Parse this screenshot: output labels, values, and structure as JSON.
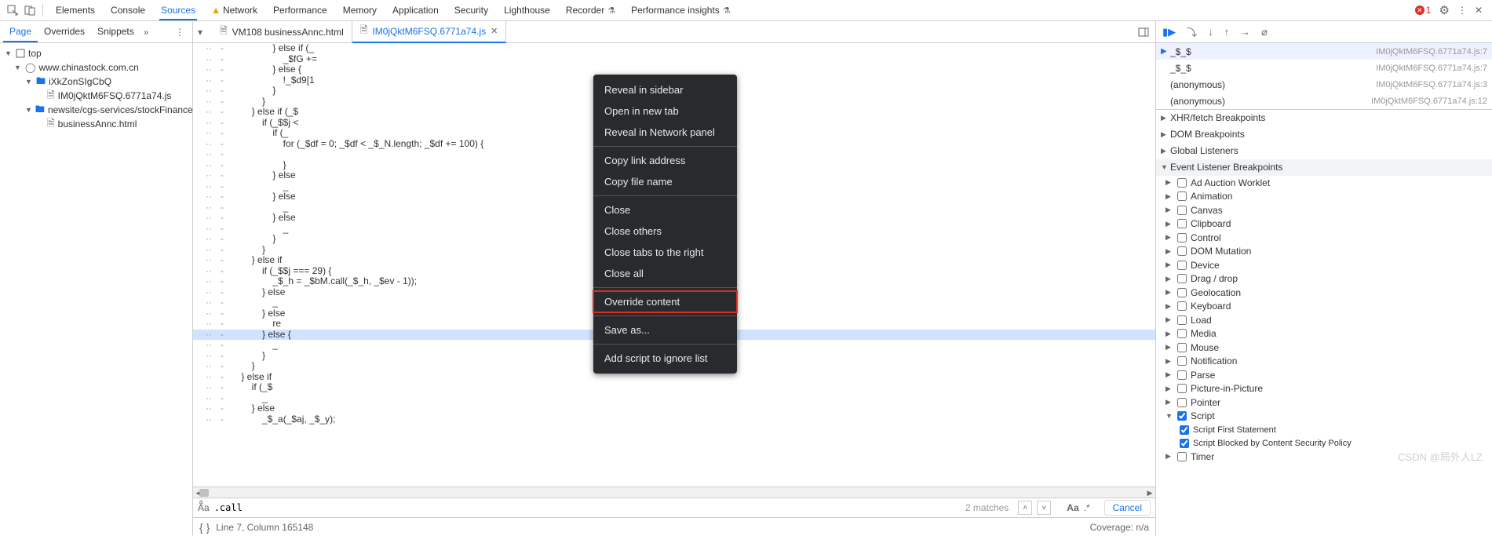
{
  "topTabs": {
    "items": [
      "Elements",
      "Console",
      "Sources",
      "Network",
      "Performance",
      "Memory",
      "Application",
      "Security",
      "Lighthouse",
      "Recorder",
      "Performance insights"
    ],
    "activeIndex": 2,
    "warnIndex": 3,
    "beakerIndices": [
      9,
      10
    ]
  },
  "topRight": {
    "errorCount": "1"
  },
  "leftTabs": {
    "items": [
      "Page",
      "Overrides",
      "Snippets"
    ],
    "activeIndex": 0
  },
  "fileTree": {
    "root": "top",
    "domain": "www.chinastock.com.cn",
    "folders": [
      {
        "name": "iXkZonSIgCbQ",
        "files": [
          "IM0jQktM6FSQ.6771a74.js"
        ]
      },
      {
        "name": "newsite/cgs-services/stockFinance",
        "files": [
          "businessAnnc.html"
        ]
      }
    ]
  },
  "fileTabs": {
    "tabs": [
      {
        "label": "VM108 businessAnnc.html",
        "icon": "doc",
        "active": false
      },
      {
        "label": "IM0jQktM6FSQ.6771a74.js",
        "icon": "js",
        "active": true
      }
    ]
  },
  "code": {
    "lines": [
      "                } else if (_",
      "                    _$fG +=",
      "                } else {",
      "                    !_$d9[1",
      "                }",
      "            }",
      "        } else if (_$",
      "            if (_$$j <",
      "                if (_",
      "                    for (_$df = 0; _$df < _$_N.length; _$df += 100) {",
      "                        ",
      "                    }",
      "                } else",
      "                    _",
      "                } else",
      "                    _",
      "                } else",
      "                    _",
      "                }",
      "            }",
      "        } else if",
      "            if (_$$j === 29) {",
      "                _$_h = _$bM.call(_$_h, _$ev - 1));",
      "            } else",
      "                _",
      "            } else",
      "                re",
      "            } else {",
      "                _",
      "            }",
      "        }",
      "    } else if",
      "        if (_$",
      "            _",
      "        } else",
      "            _$_a(_$aj, _$_y);"
    ],
    "highlightLine": 27
  },
  "searchBar": {
    "value": ".call",
    "matches": "2 matches",
    "cancel": "Cancel"
  },
  "statusBar": {
    "position": "Line 7, Column 165148",
    "coverage": "Coverage: n/a"
  },
  "contextMenu": {
    "groups": [
      [
        "Reveal in sidebar",
        "Open in new tab",
        "Reveal in Network panel"
      ],
      [
        "Copy link address",
        "Copy file name"
      ],
      [
        "Close",
        "Close others",
        "Close tabs to the right",
        "Close all"
      ],
      [
        "Override content"
      ],
      [
        "Save as..."
      ],
      [
        "Add script to ignore list"
      ]
    ],
    "highlighted": "Override content"
  },
  "callStack": [
    {
      "name": "_$_$",
      "loc": "IM0jQktM6FSQ.6771a74.js:7",
      "top": true
    },
    {
      "name": "_$_$",
      "loc": "IM0jQktM6FSQ.6771a74.js:7"
    },
    {
      "name": "(anonymous)",
      "loc": "IM0jQktM6FSQ.6771a74.js:3"
    },
    {
      "name": "(anonymous)",
      "loc": "IM0jQktM6FSQ.6771a74.js:12"
    }
  ],
  "breakpointSections": [
    "XHR/fetch Breakpoints",
    "DOM Breakpoints",
    "Global Listeners",
    "Event Listener Breakpoints"
  ],
  "eventCategories": [
    {
      "name": "Ad Auction Worklet",
      "checked": false
    },
    {
      "name": "Animation",
      "checked": false
    },
    {
      "name": "Canvas",
      "checked": false
    },
    {
      "name": "Clipboard",
      "checked": false
    },
    {
      "name": "Control",
      "checked": false
    },
    {
      "name": "DOM Mutation",
      "checked": false
    },
    {
      "name": "Device",
      "checked": false
    },
    {
      "name": "Drag / drop",
      "checked": false
    },
    {
      "name": "Geolocation",
      "checked": false
    },
    {
      "name": "Keyboard",
      "checked": false
    },
    {
      "name": "Load",
      "checked": false
    },
    {
      "name": "Media",
      "checked": false
    },
    {
      "name": "Mouse",
      "checked": false
    },
    {
      "name": "Notification",
      "checked": false
    },
    {
      "name": "Parse",
      "checked": false
    },
    {
      "name": "Picture-in-Picture",
      "checked": false
    },
    {
      "name": "Pointer",
      "checked": false
    },
    {
      "name": "Script",
      "checked": true,
      "expanded": true,
      "subs": [
        {
          "name": "Script First Statement",
          "checked": true
        },
        {
          "name": "Script Blocked by Content Security Policy",
          "checked": true
        }
      ]
    },
    {
      "name": "Timer",
      "checked": false
    }
  ],
  "watermark": "CSDN @局外人LZ"
}
